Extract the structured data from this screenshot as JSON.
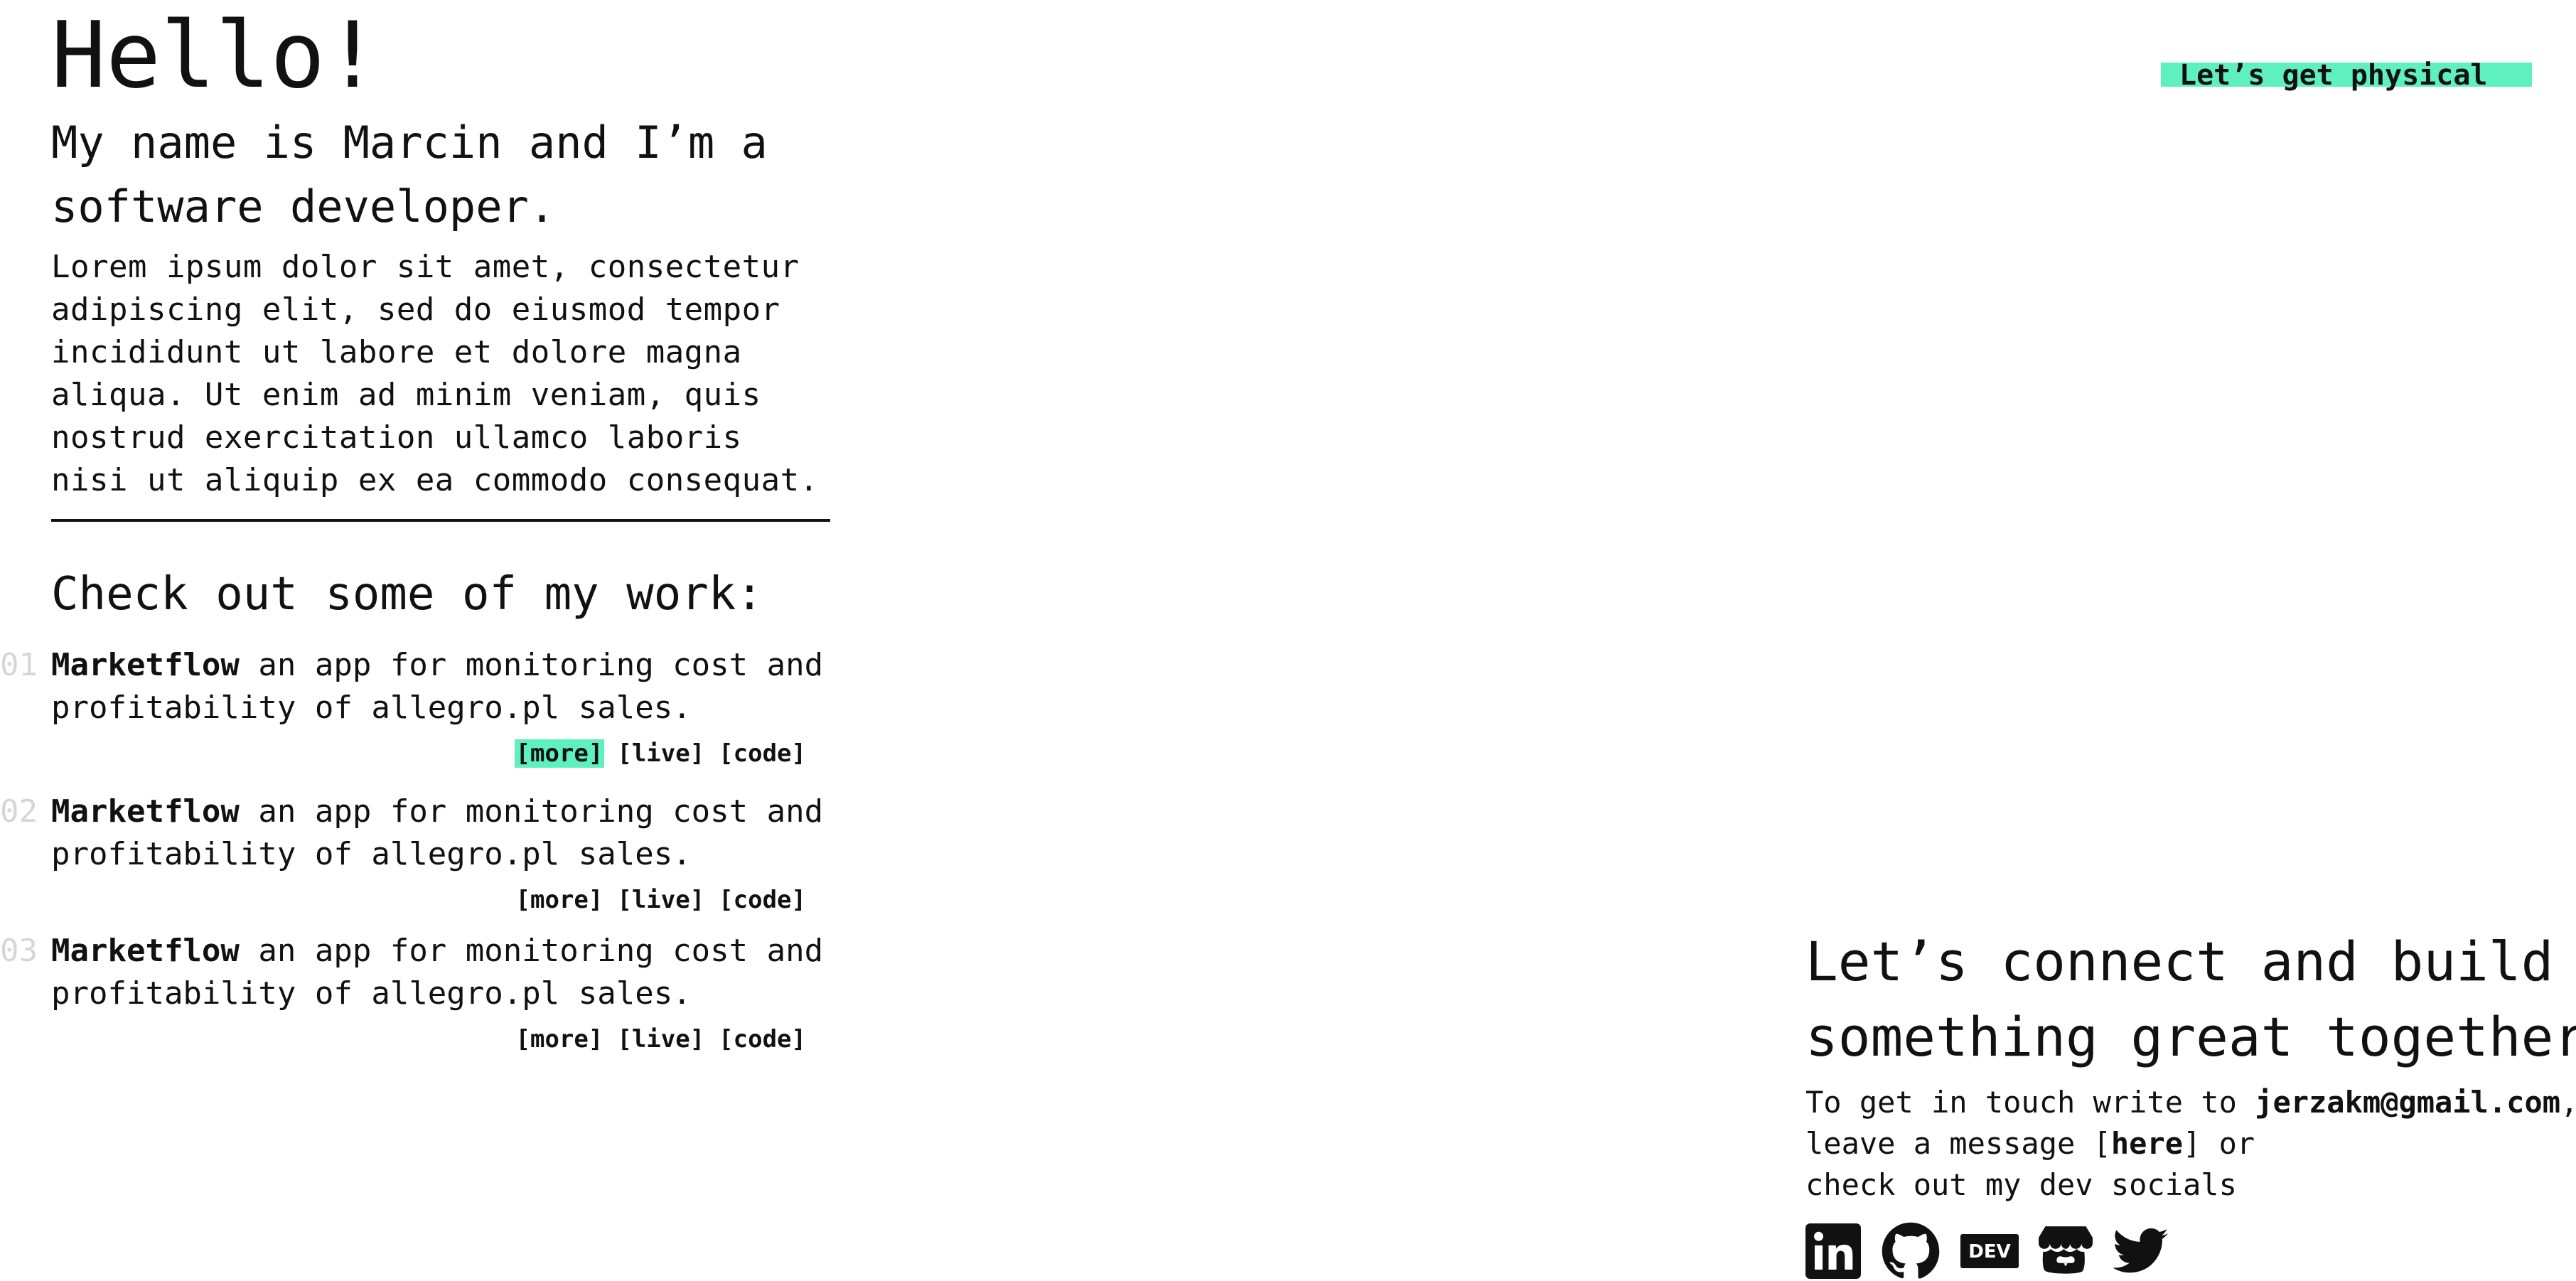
{
  "hero": {
    "hello": "Hello!",
    "intro": "My name is Marcin and I’m a software developer.",
    "lorem": "Lorem ipsum dolor sit amet, consectetur adipiscing elit, sed do eiusmod tempor in­cididunt ut labore et dolore magna aliqua. Ut enim ad minim veniam, quis nostrud ex­ercitation ullamco laboris nisi ut aliquip ex ea commodo consequat."
  },
  "work": {
    "heading": "Check out some of my work:",
    "projects": [
      {
        "number": "01",
        "name": "Marketflow",
        "description": " an app for monitoring cost and profitability of allegro.pl sales.",
        "links": [
          "[more]",
          "[live]",
          "[code]"
        ]
      },
      {
        "number": "02",
        "name": "Marketflow",
        "description": " an app for monitoring cost and profitability of allegro.pl sales.",
        "links": [
          "[more]",
          "[live]",
          "[code]"
        ]
      },
      {
        "number": "03",
        "name": "Marketflow",
        "description": " an app for monitoring cost and profitability of allegro.pl sales.",
        "links": [
          "[more]",
          "[live]",
          "[code]"
        ]
      }
    ]
  },
  "header": {
    "physical_button": "Let’s get physical"
  },
  "connect": {
    "heading_line1": "Let’s connect and build",
    "heading_line2": "something great together",
    "line1_prefix": "To get in touch write to ",
    "email": "jerzakm@gmail.com",
    "line1_suffix": ",",
    "line2_prefix": "leave a message [",
    "here_link": "here",
    "line2_suffix": "] or",
    "line3": "check out my dev socials",
    "socials": [
      "linkedin-icon",
      "github-icon",
      "dev-icon",
      "itchio-icon",
      "twitter-icon"
    ],
    "dev_label": "DEV"
  },
  "colors": {
    "accent": "#5ff0c0",
    "text": "#111111",
    "muted_number": "#d6d6d6"
  }
}
